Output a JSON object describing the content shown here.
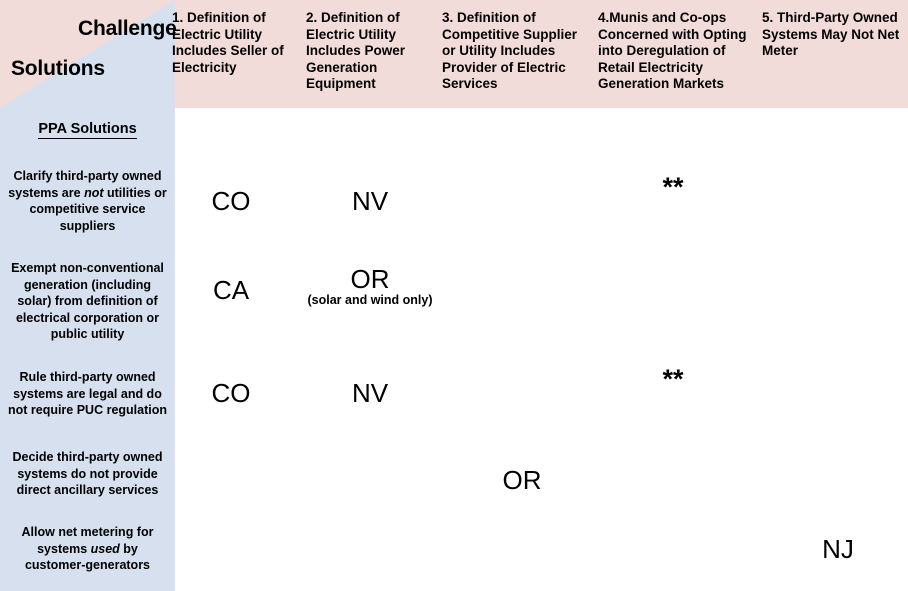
{
  "axes": {
    "challenge_label": "Challenge",
    "solutions_label": "Solutions"
  },
  "colors": {
    "challenge_band": "#f2dcda",
    "solutions_band": "#d6e0ee",
    "text": "#000000",
    "background": "#ffffff"
  },
  "columns": [
    {
      "id": "col1",
      "label": "1. Definition of Electric Utility Includes Seller of Electricity"
    },
    {
      "id": "col2",
      "label": "2. Definition of Electric Utility Includes Power Generation Equipment"
    },
    {
      "id": "col3",
      "label": "3. Definition of Competitive Supplier or Utility Includes Provider of Electric Services"
    },
    {
      "id": "col4",
      "label": "4.Munis and Co-ops Concerned with Opting into Deregulation of Retail Electricity Generation Markets"
    },
    {
      "id": "col5",
      "label": "5. Third-Party Owned Systems May Not Net Meter"
    }
  ],
  "sidebar": {
    "section_title": "PPA Solutions",
    "rows": [
      {
        "id": "row1",
        "label_html": "Clarify third-party owned systems are <i>not</i> utilities or competitive service suppliers"
      },
      {
        "id": "row2",
        "label_html": "Exempt non-conventional generation (including solar) from definition of electrical corporation or public utility"
      },
      {
        "id": "row3",
        "label_html": "Rule third-party owned systems are legal and do not require PUC regulation"
      },
      {
        "id": "row4",
        "label_html": "Decide third-party owned systems do not provide direct ancillary services"
      },
      {
        "id": "row5",
        "label_html": "Allow net metering for systems <i>used</i> by customer-generators"
      }
    ]
  },
  "cells": [
    {
      "id": "c_r1_c1",
      "row": "row1",
      "column": "col1",
      "value": "CO",
      "note": ""
    },
    {
      "id": "c_r1_c2",
      "row": "row1",
      "column": "col2",
      "value": "NV",
      "note": ""
    },
    {
      "id": "c_r1_c4",
      "row": "row1",
      "column": "col4",
      "value": "**",
      "note": ""
    },
    {
      "id": "c_r2_c1",
      "row": "row2",
      "column": "col1",
      "value": "CA",
      "note": ""
    },
    {
      "id": "c_r2_c2",
      "row": "row2",
      "column": "col2",
      "value": "OR",
      "note": "(solar and wind only)"
    },
    {
      "id": "c_r3_c1",
      "row": "row3",
      "column": "col1",
      "value": "CO",
      "note": ""
    },
    {
      "id": "c_r3_c2",
      "row": "row3",
      "column": "col2",
      "value": "NV",
      "note": ""
    },
    {
      "id": "c_r3_c4",
      "row": "row3",
      "column": "col4",
      "value": "**",
      "note": ""
    },
    {
      "id": "c_r4_c3",
      "row": "row4",
      "column": "col3",
      "value": "OR",
      "note": ""
    },
    {
      "id": "c_r5_c5",
      "row": "row5",
      "column": "col5",
      "value": "NJ",
      "note": ""
    }
  ]
}
